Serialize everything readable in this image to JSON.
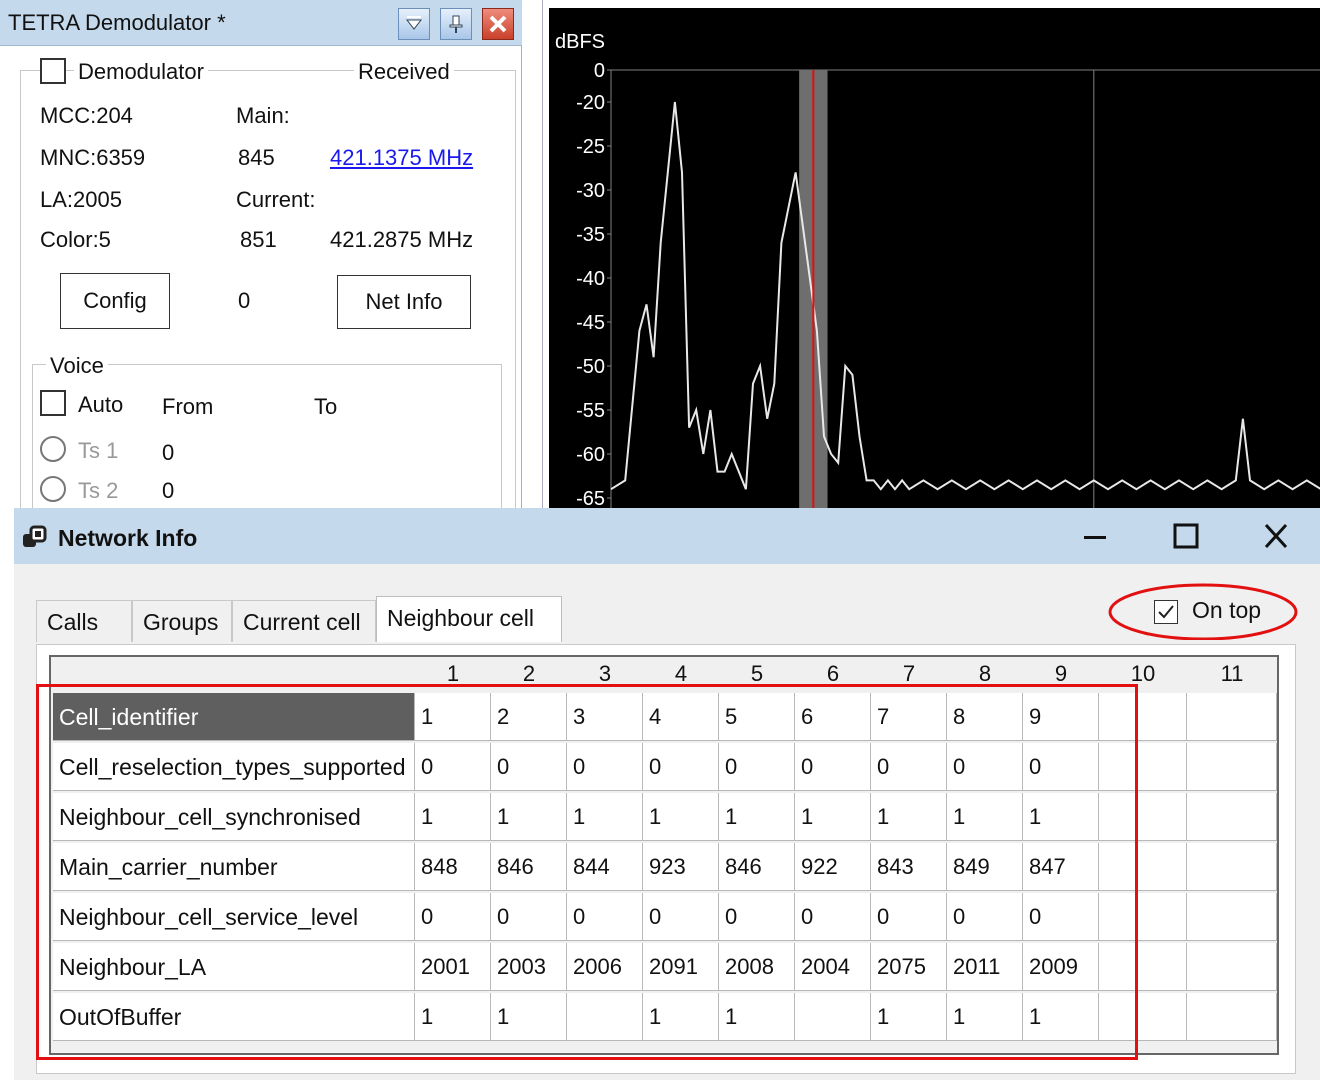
{
  "tetra": {
    "title": "TETRA Demodulator *",
    "demodulator_label": "Demodulator",
    "received_label": "Received",
    "mcc": "MCC:204",
    "mnc": "MNC:6359",
    "la": "LA:2005",
    "color": "Color:5",
    "main_label": "Main:",
    "main_channel": "845",
    "main_freq": "421.1375 MHz",
    "current_label": "Current:",
    "current_channel": "851",
    "current_freq": "421.2875 MHz",
    "config_button": "Config",
    "counter": "0",
    "net_info_button": "Net Info",
    "voice_label": "Voice",
    "auto_label": "Auto",
    "from_label": "From",
    "to_label": "To",
    "ts1_label": "Ts 1",
    "ts1_value": "0",
    "ts2_label": "Ts 2",
    "ts2_value": "0"
  },
  "spectrum": {
    "unit_label": "dBFS",
    "y_ticks": [
      "0",
      "-20",
      "-25",
      "-30",
      "-35",
      "-40",
      "-45",
      "-50",
      "-55",
      "-60",
      "-65"
    ],
    "colors": {
      "background": "#000000",
      "grid": "#808080",
      "trace": "#e8e8e8",
      "marker": "#e01010",
      "band": "#6e6e6e"
    }
  },
  "chart_data": {
    "type": "line",
    "ylabel": "dBFS",
    "ylim": [
      -66,
      0
    ],
    "y_tick_labels": [
      "0",
      "-20",
      "-25",
      "-30",
      "-35",
      "-40",
      "-45",
      "-50",
      "-55",
      "-60",
      "-65"
    ],
    "x_range": [
      0,
      100
    ],
    "series": [
      {
        "x": [
          0,
          2,
          4,
          5,
          6,
          7,
          8,
          9,
          10,
          11,
          12,
          13,
          14,
          15,
          16,
          17,
          18,
          19,
          20,
          21,
          22,
          23,
          24,
          25,
          26,
          27,
          28,
          29,
          30,
          31,
          32,
          33,
          34,
          35,
          36,
          37,
          38,
          39,
          40,
          41,
          42,
          44,
          46,
          48,
          50,
          52,
          54,
          56,
          58,
          60,
          62,
          64,
          66,
          68,
          70,
          72,
          74,
          76,
          78,
          80,
          82,
          84,
          86,
          88,
          89,
          90,
          92,
          94,
          96,
          98,
          100
        ],
        "values": [
          -64,
          -63,
          -46,
          -43,
          -49,
          -36,
          -28,
          -20,
          -28,
          -57,
          -55,
          -60,
          -55,
          -62,
          -62,
          -60,
          -62,
          -64,
          -52,
          -50,
          -56,
          -52,
          -36,
          -32,
          -28,
          -34,
          -40,
          -46,
          -58,
          -60,
          -61,
          -50,
          -51,
          -58,
          -63,
          -63,
          -64,
          -63,
          -64,
          -63,
          -64,
          -63,
          -64,
          -63,
          -64,
          -63,
          -64,
          -63,
          -64,
          -63,
          -64,
          -63,
          -64,
          -63,
          -64,
          -63,
          -64,
          -63,
          -64,
          -63,
          -64,
          -63,
          -64,
          -63,
          -56,
          -63,
          -64,
          -63,
          -64,
          -63,
          -64
        ]
      }
    ],
    "marker_x": 28.5,
    "band_x": [
      26.5,
      30.5
    ],
    "grid": true
  },
  "netinfo": {
    "title": "Network Info",
    "tabs": [
      "Calls",
      "Groups",
      "Current cell",
      "Neighbour cell"
    ],
    "active_tab": "Neighbour cell",
    "on_top_label": "On top",
    "columns": [
      "1",
      "2",
      "3",
      "4",
      "5",
      "6",
      "7",
      "8",
      "9",
      "10",
      "11"
    ],
    "rows": [
      {
        "label": "Cell_identifier",
        "values": [
          "1",
          "2",
          "3",
          "4",
          "5",
          "6",
          "7",
          "8",
          "9",
          "",
          ""
        ]
      },
      {
        "label": "Cell_reselection_types_supported",
        "values": [
          "0",
          "0",
          "0",
          "0",
          "0",
          "0",
          "0",
          "0",
          "0",
          "",
          ""
        ]
      },
      {
        "label": "Neighbour_cell_synchronised",
        "values": [
          "1",
          "1",
          "1",
          "1",
          "1",
          "1",
          "1",
          "1",
          "1",
          "",
          ""
        ]
      },
      {
        "label": "Main_carrier_number",
        "values": [
          "848",
          "846",
          "844",
          "923",
          "846",
          "922",
          "843",
          "849",
          "847",
          "",
          ""
        ]
      },
      {
        "label": "Neighbour_cell_service_level",
        "values": [
          "0",
          "0",
          "0",
          "0",
          "0",
          "0",
          "0",
          "0",
          "0",
          "",
          ""
        ]
      },
      {
        "label": "Neighbour_LA",
        "values": [
          "2001",
          "2003",
          "2006",
          "2091",
          "2008",
          "2004",
          "2075",
          "2011",
          "2009",
          "",
          ""
        ]
      },
      {
        "label": "OutOfBuffer",
        "values": [
          "1",
          "1",
          "",
          "1",
          "1",
          "",
          "1",
          "1",
          "1",
          "",
          ""
        ]
      }
    ],
    "highlight_color": "#e21010"
  }
}
